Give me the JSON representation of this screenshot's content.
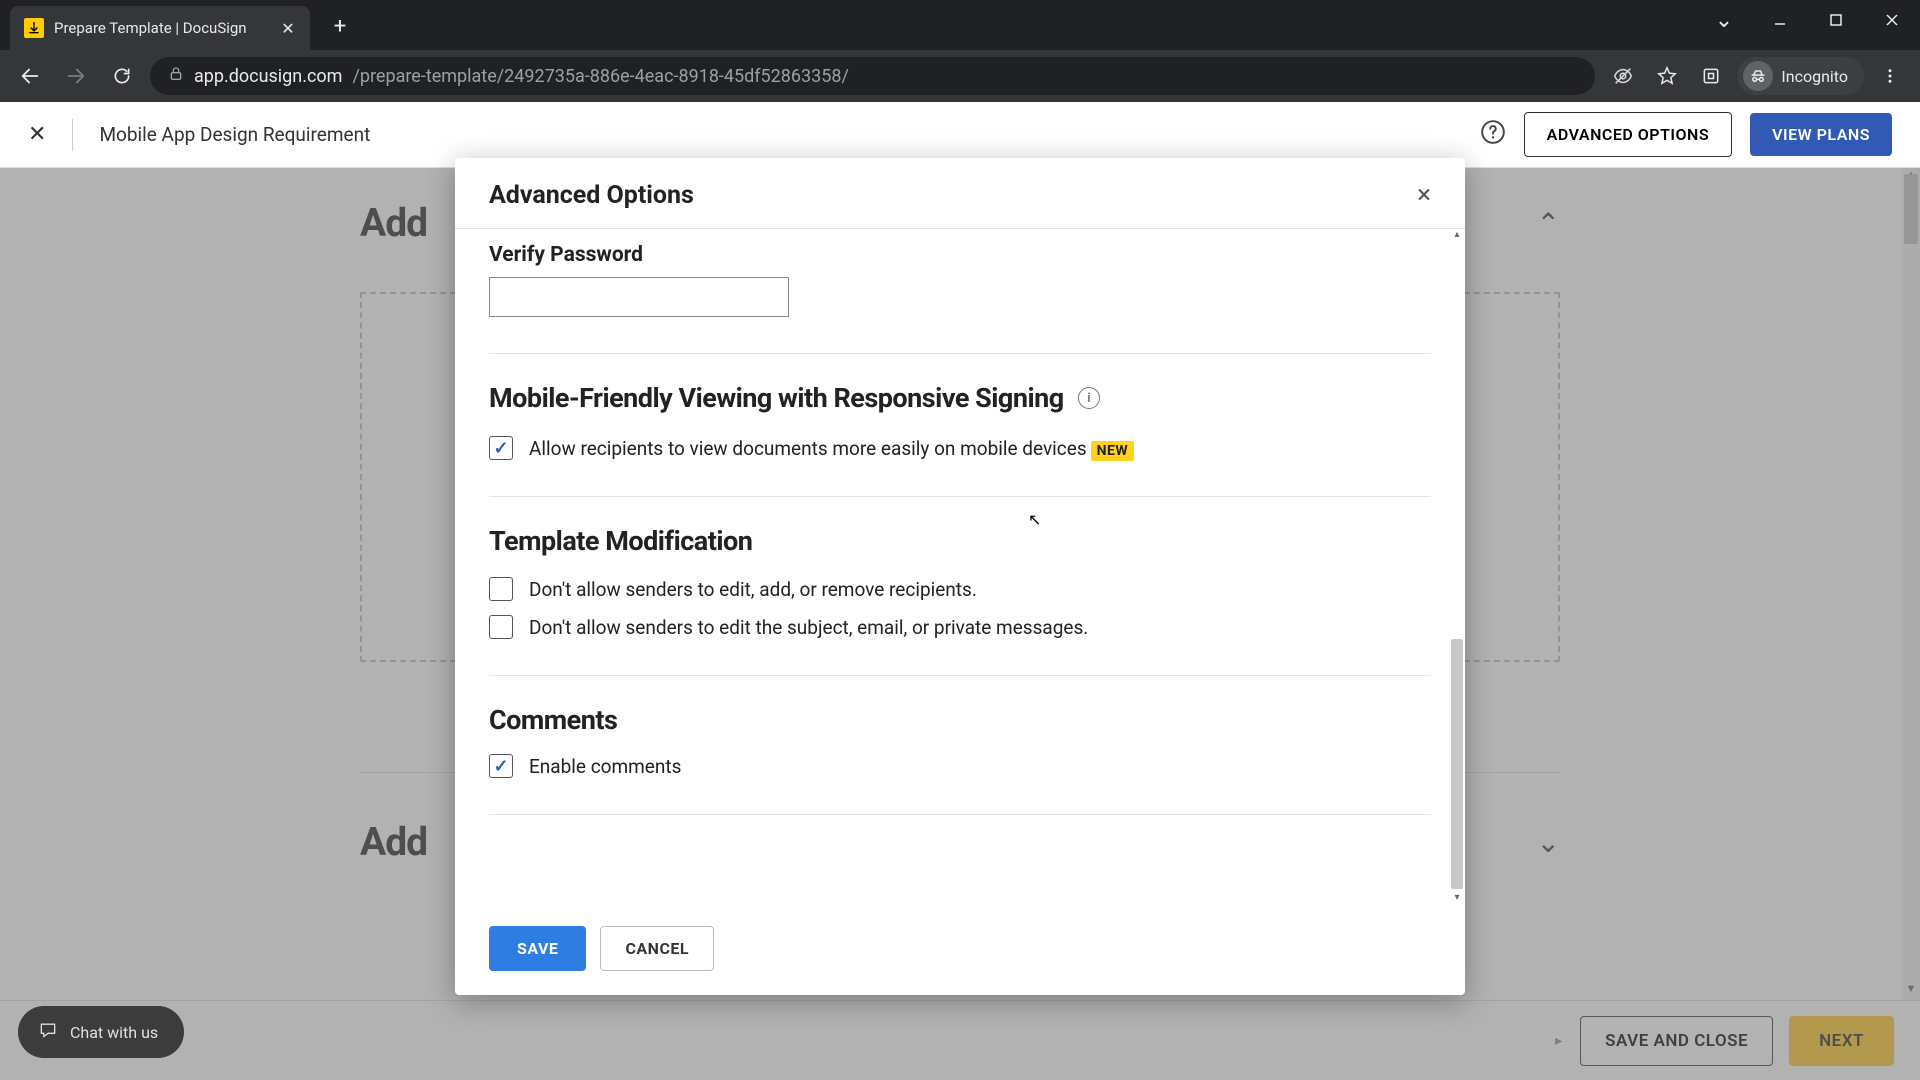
{
  "browser": {
    "tab_title": "Prepare Template | DocuSign",
    "url_host": "app.docusign.com",
    "url_path": "/prepare-template/2492735a-886e-4eac-8918-45df52863358/",
    "incognito_label": "Incognito"
  },
  "header": {
    "doc_title": "Mobile App Design Requirement",
    "advanced_options": "ADVANCED OPTIONS",
    "view_plans": "VIEW PLANS"
  },
  "main": {
    "add_heading_1": "Add",
    "add_heading_2": "Add"
  },
  "bottom": {
    "save_and_close": "SAVE AND CLOSE",
    "next": "NEXT"
  },
  "chat": {
    "label": "Chat with us"
  },
  "modal": {
    "title": "Advanced Options",
    "verify_password_label": "Verify Password",
    "mobile_heading": "Mobile-Friendly Viewing with Responsive Signing",
    "mobile_checkbox_label": "Allow recipients to view documents more easily on mobile devices",
    "new_badge": "NEW",
    "template_mod_heading": "Template Modification",
    "tm_opt1": "Don't allow senders to edit, add, or remove recipients.",
    "tm_opt2": "Don't allow senders to edit the subject, email, or private messages.",
    "comments_heading": "Comments",
    "comments_checkbox_label": "Enable comments",
    "save": "SAVE",
    "cancel": "CANCEL",
    "mobile_checked": true,
    "tm1_checked": false,
    "tm2_checked": false,
    "comments_checked": true
  }
}
